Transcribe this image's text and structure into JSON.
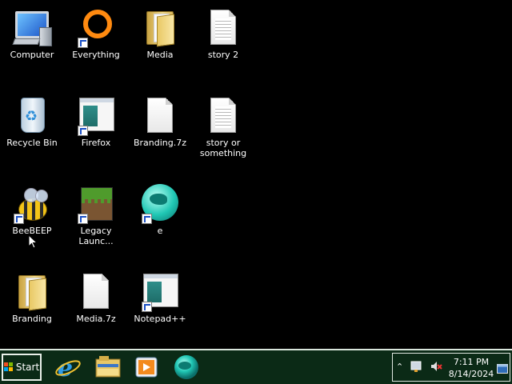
{
  "desktop": {
    "icons": [
      {
        "label": "Computer"
      },
      {
        "label": "Everything"
      },
      {
        "label": "Media"
      },
      {
        "label": "story 2"
      },
      {
        "label": "Recycle Bin"
      },
      {
        "label": "Firefox"
      },
      {
        "label": "Branding.7z"
      },
      {
        "label": "story or something"
      },
      {
        "label": "BeeBEEP"
      },
      {
        "label": "Legacy Launc..."
      },
      {
        "label": "e"
      },
      {
        "label": "Branding"
      },
      {
        "label": "Media.7z"
      },
      {
        "label": "Notepad++"
      }
    ]
  },
  "taskbar": {
    "start_label": "Start",
    "pinned": [
      {
        "icon": "internet-explorer-icon"
      },
      {
        "icon": "file-explorer-icon"
      },
      {
        "icon": "media-player-icon"
      },
      {
        "icon": "e-app-icon"
      }
    ],
    "tray": {
      "time": "7:11 PM",
      "date": "8/14/2024",
      "icons": [
        "show-hidden-icons-icon",
        "network-icon",
        "volume-muted-icon",
        "show-desktop-icon"
      ]
    }
  },
  "colors": {
    "desktop_bg": "#000000",
    "taskbar_bg": "#0b2a16",
    "taskbar_border": "#d9e6dc"
  }
}
